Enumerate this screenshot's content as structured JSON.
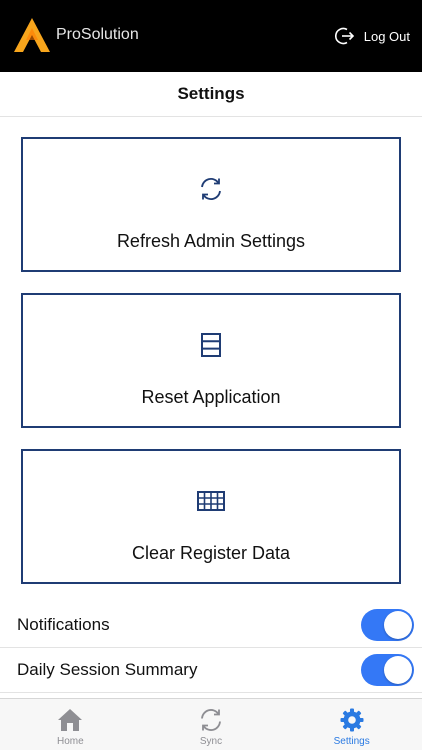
{
  "header": {
    "app_title": "ProSolution",
    "logout_label": "Log Out"
  },
  "page": {
    "title": "Settings"
  },
  "cards": [
    {
      "label": "Refresh Admin Settings",
      "icon": "refresh-icon"
    },
    {
      "label": "Reset Application",
      "icon": "list-icon"
    },
    {
      "label": "Clear Register Data",
      "icon": "grid-icon"
    }
  ],
  "toggles": [
    {
      "label": "Notifications",
      "on": true
    },
    {
      "label": "Daily Session Summary",
      "on": true
    }
  ],
  "tabs": [
    {
      "label": "Home",
      "icon": "home-icon",
      "active": false
    },
    {
      "label": "Sync",
      "icon": "sync-icon",
      "active": false
    },
    {
      "label": "Settings",
      "icon": "gear-icon",
      "active": true
    }
  ],
  "colors": {
    "accent": "#3478f6",
    "card_border": "#1f3c74",
    "logo_orange": "#f5a623",
    "tab_active": "#2a7ae2",
    "tab_inactive": "#8e8e93"
  }
}
